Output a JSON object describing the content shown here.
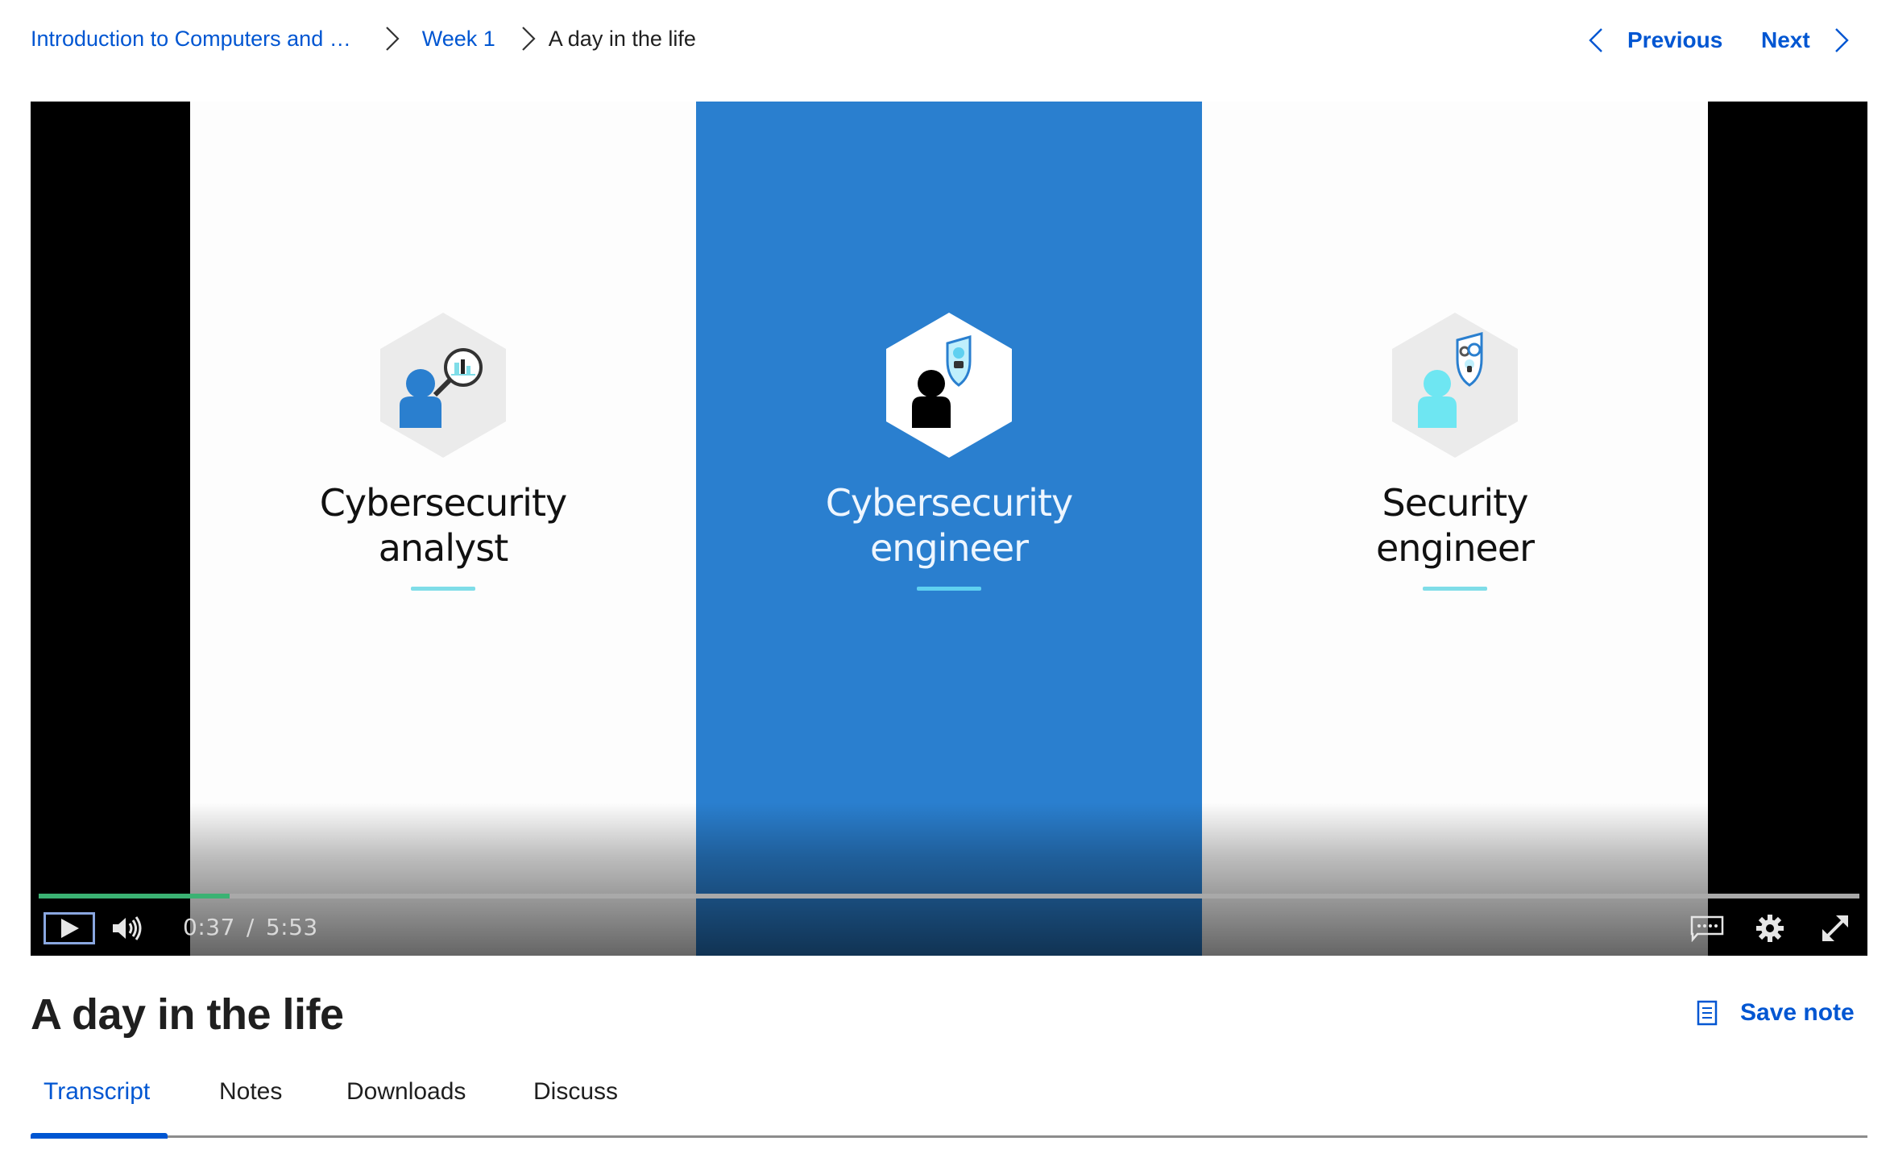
{
  "breadcrumb": {
    "items": [
      {
        "label": "Introduction to Computers and …"
      },
      {
        "label": "Week 1"
      },
      {
        "label": "A day in the life"
      }
    ]
  },
  "nav": {
    "previous_label": "Previous",
    "next_label": "Next"
  },
  "video": {
    "panels": [
      {
        "line1": "Cybersecurity",
        "line2": "analyst",
        "icon": "analyst-magnifier-icon"
      },
      {
        "line1": "Cybersecurity",
        "line2": "engineer",
        "icon": "engineer-shield-icon"
      },
      {
        "line1": "Security",
        "line2": "engineer",
        "icon": "security-engineer-gear-shield-icon"
      }
    ],
    "current_time": "0:37",
    "separator": "/",
    "duration": "5:53",
    "progress_fraction": 0.105,
    "state": "paused",
    "colors": {
      "progress": "#3bb273",
      "panel_accent": "#2a7fcf"
    }
  },
  "page": {
    "title": "A day in the life",
    "save_note_label": "Save note"
  },
  "tabs": [
    {
      "label": "Transcript",
      "active": true
    },
    {
      "label": "Notes",
      "active": false
    },
    {
      "label": "Downloads",
      "active": false
    },
    {
      "label": "Discuss",
      "active": false
    }
  ],
  "colors": {
    "link": "#0056d2",
    "text": "#1f1f1f"
  }
}
